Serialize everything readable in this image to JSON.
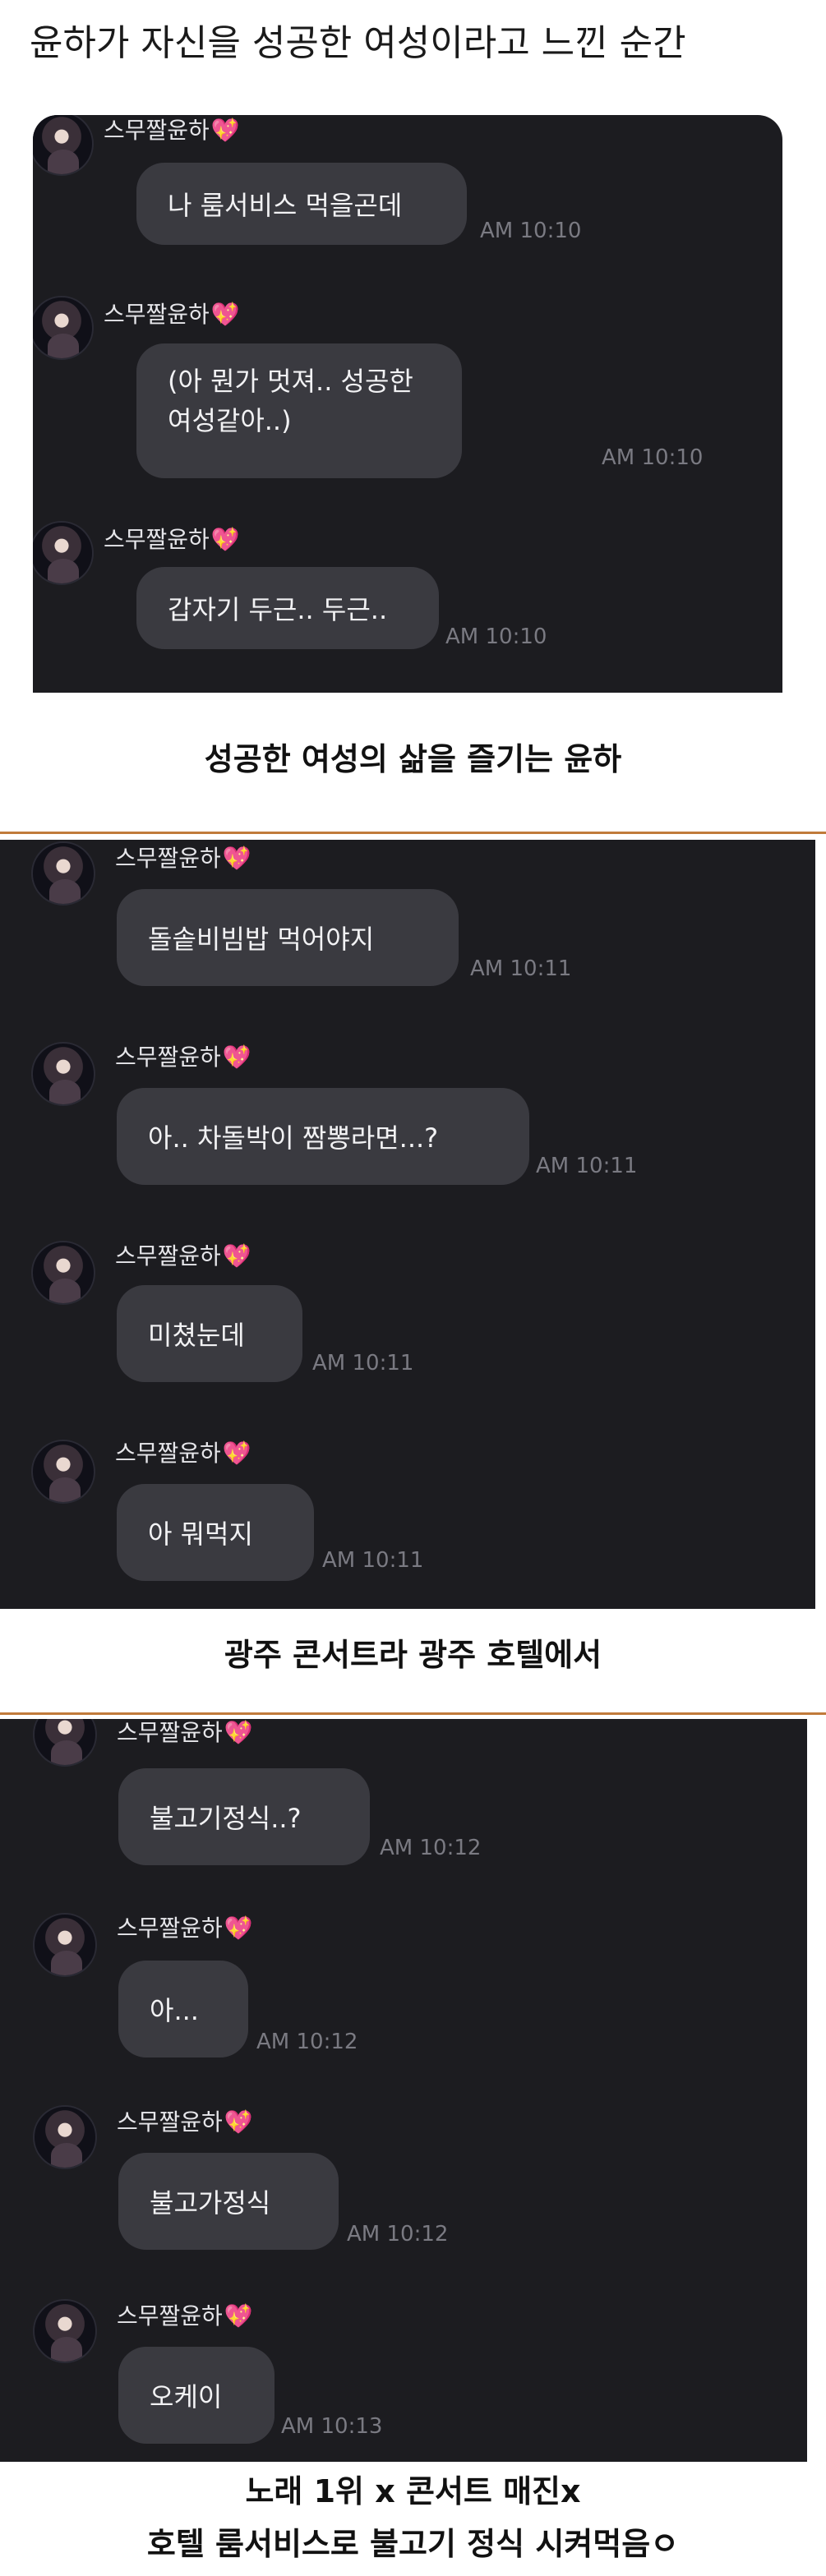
{
  "page": {
    "title": "윤하가 자신을 성공한 여성이라고 느낀 순간"
  },
  "sender_name": "스무짤윤하",
  "heart_icon": "💖",
  "panels": [
    {
      "messages": [
        {
          "text": "나 룸서비스 먹을곤데",
          "time": "AM 10:10"
        },
        {
          "text": "(아 뭔가 멋져.. 성공한 여성같아..)",
          "time": "AM 10:10"
        },
        {
          "text": "갑자기 두근.. 두근..",
          "time": "AM 10:10"
        }
      ]
    },
    {
      "messages": [
        {
          "text": "돌솥비빔밥 먹어야지",
          "time": "AM 10:11"
        },
        {
          "text": "아.. 차돌박이 짬뽕라면...?",
          "time": "AM 10:11"
        },
        {
          "text": "미쳤눈데",
          "time": "AM 10:11"
        },
        {
          "text": "아 뭐먹지",
          "time": "AM 10:11"
        }
      ]
    },
    {
      "messages": [
        {
          "text": "불고기정식..?",
          "time": "AM 10:12"
        },
        {
          "text": "아...",
          "time": "AM 10:12"
        },
        {
          "text": "불고가정식",
          "time": "AM 10:12"
        },
        {
          "text": "오케이",
          "time": "AM 10:13"
        }
      ]
    }
  ],
  "captions": {
    "c1": "성공한 여성의 삶을 즐기는 윤하",
    "c2": "광주 콘서트라 광주 호텔에서",
    "c3": "노래 1위 x 콘서트 매진x",
    "c4": "호텔 룸서비스로 불고기 정식 시켜먹음ㅇ"
  },
  "colors": {
    "chat_background": "#1c1c20",
    "bubble": "#3a3a40",
    "divider": "#c07a3a",
    "heart": "#ff5fa8"
  }
}
